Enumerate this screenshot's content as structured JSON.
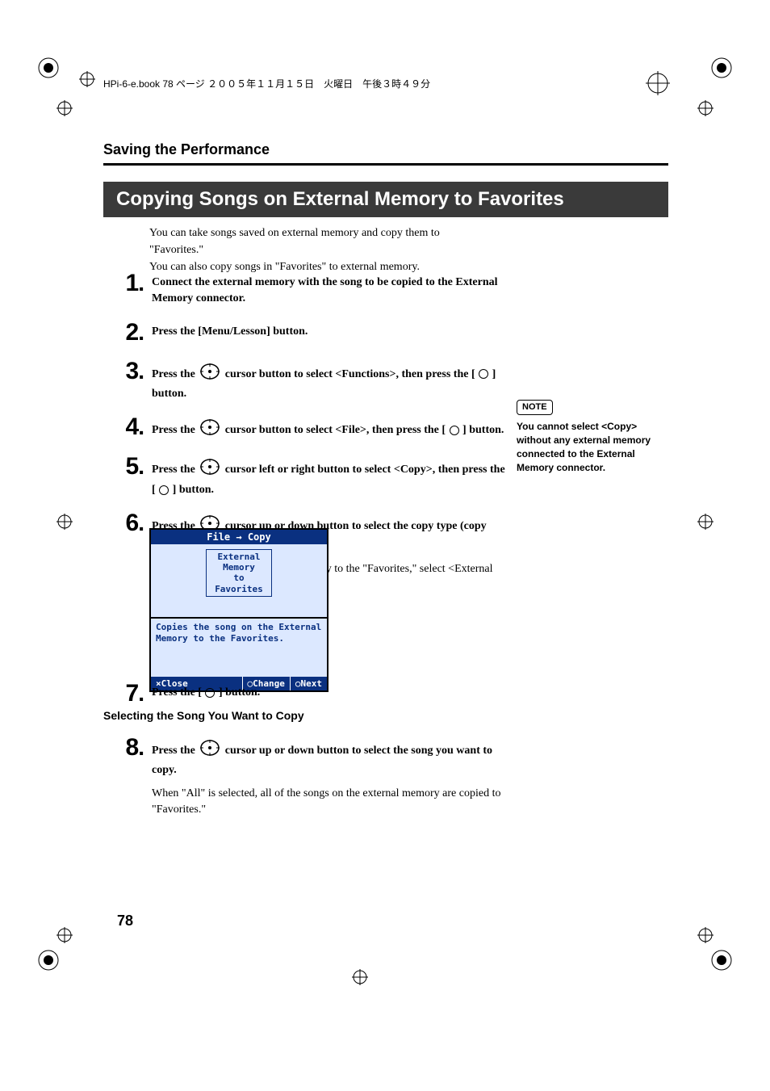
{
  "header": {
    "book_info": "HPi-6-e.book 78 ページ ２００５年１１月１５日　火曜日　午後３時４９分"
  },
  "section_title": "Saving the Performance",
  "banner": "Copying Songs on External Memory to Favorites",
  "intro_line1": "You can take songs saved on external memory and copy them to \"Favorites.\"",
  "intro_line2": "You can also copy songs in \"Favorites\" to external memory.",
  "steps": {
    "s1": "Connect the external memory with the song to be copied to the External Memory connector.",
    "s2": "Press the [Menu/Lesson] button.",
    "s3a": "Press the ",
    "s3b": " cursor button to select <Functions>, then press the [ ",
    "s3c": " ] button.",
    "s4a": "Press the ",
    "s4b": " cursor button to select <File>, then press the [ ",
    "s4c": " ] button.",
    "s5a": "Press the ",
    "s5b": " cursor left or right button to select <Copy>, then press the [ ",
    "s5c": " ] button.",
    "s6a": "Press the ",
    "s6b": " cursor up or down button to select the copy type (copy source and destination).",
    "s6note": "If copying songs from external memory to the \"Favorites,\" select <External Memory to Favorites>.",
    "s7a": "Press the [ ",
    "s7b": " ] button.",
    "s8a": "Press the ",
    "s8b": " cursor up or down button to select the song you want to copy.",
    "s8note": "When \"All\" is selected, all of the songs on the external memory are copied to \"Favorites.\""
  },
  "note": {
    "label": "NOTE",
    "text": "You cannot select <Copy> without any external memory connected to the External Memory connector."
  },
  "lcd": {
    "title": "File → Copy",
    "sel_l1": "External",
    "sel_l2": "Memory",
    "sel_l3": "to",
    "sel_l4": "Favorites",
    "body": "Copies the song on the External Memory to the Favorites.",
    "f1": "×Close",
    "f2": "◯Change",
    "f3": "○Next"
  },
  "subhead": "Selecting the Song You Want to Copy",
  "page_number": "78"
}
